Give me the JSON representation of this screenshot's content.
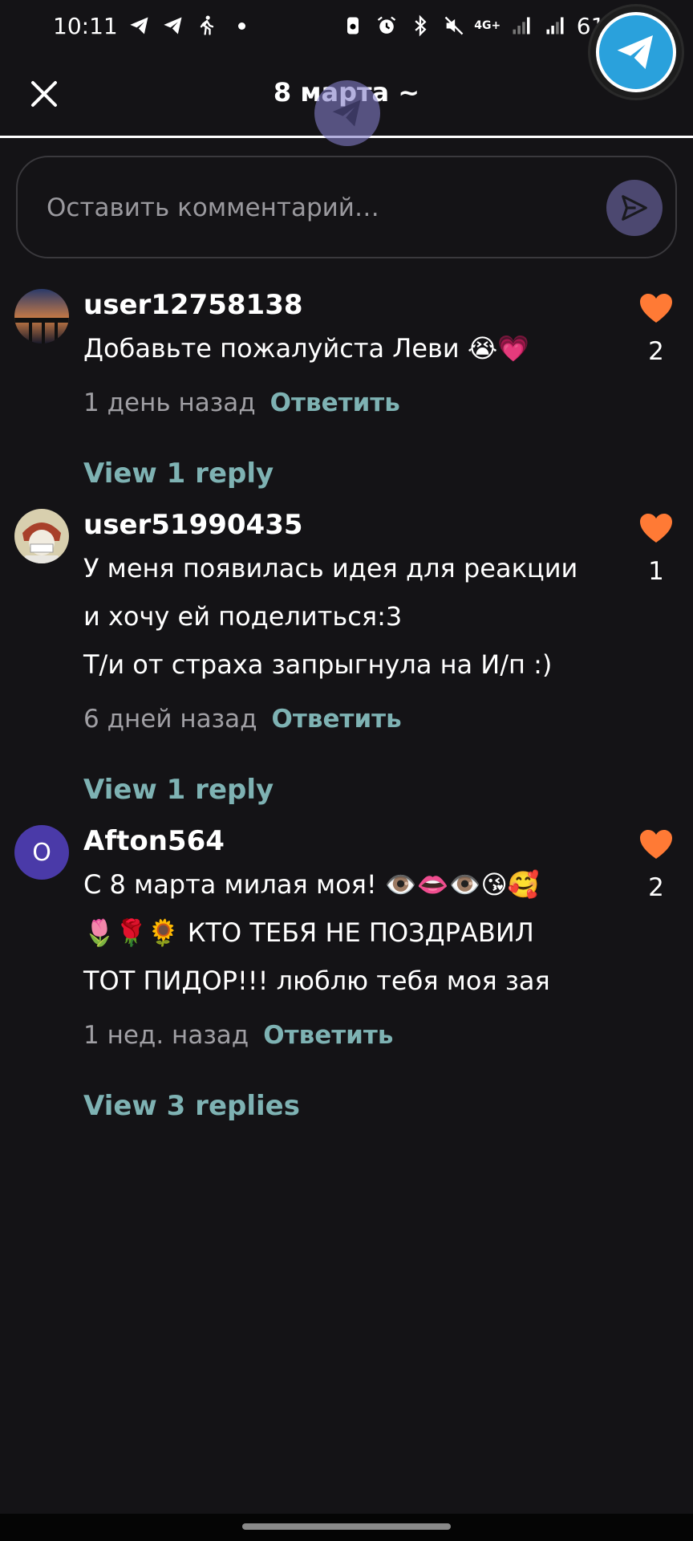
{
  "status_bar": {
    "time": "10:11",
    "battery": "61%",
    "network": "4G+"
  },
  "header": {
    "title": "8 марта ~"
  },
  "comment_input": {
    "placeholder": "Оставить комментарий…"
  },
  "comments": [
    {
      "username": "user12758138",
      "lines": [
        "Добавьте пожалуйста Леви 😭💗"
      ],
      "time": "1 день назад",
      "reply_label": "Ответить",
      "likes": "2",
      "view_replies": "View 1 reply"
    },
    {
      "username": "user51990435",
      "lines": [
        "У меня появилась идея для реакции",
        "и хочу ей поделиться:3",
        "Т/и от страха запрыгнула на И/п :)"
      ],
      "time": "6 дней назад",
      "reply_label": "Ответить",
      "likes": "1",
      "view_replies": "View 1 reply"
    },
    {
      "username": "Afton564",
      "avatar_letter": "O",
      "lines": [
        "С 8 марта милая моя! 👁️👄👁️😘🥰",
        "🌷🌹🌻 КТО ТЕБЯ НЕ ПОЗДРАВИЛ",
        "ТОТ ПИДОР!!! люблю тебя моя зая"
      ],
      "time": "1 нед. назад",
      "reply_label": "Ответить",
      "likes": "2",
      "view_replies": "View 3 replies"
    }
  ],
  "colors": {
    "background": "#141316",
    "accent_link": "#7eb2b3",
    "heart": "#ff7a35",
    "send_button": "#4c4870",
    "telegram": "#2aa1dc"
  }
}
